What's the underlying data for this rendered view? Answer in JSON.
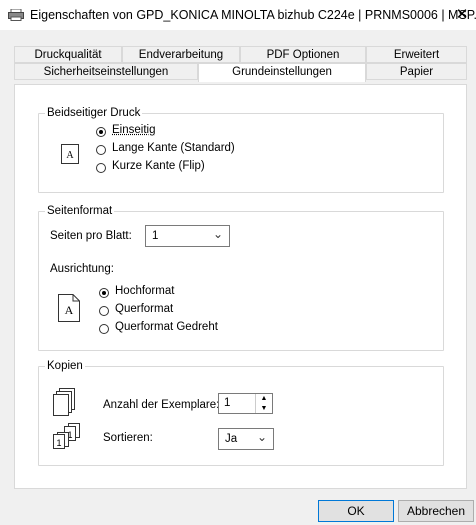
{
  "window": {
    "title": "Eigenschaften von GPD_KONICA MINOLTA bizhub C224e | PRNMS0006 | MSP...",
    "close_icon": "close-icon",
    "app_icon": "printer-icon"
  },
  "tabs": {
    "row1": [
      "Druckqualität",
      "Endverarbeitung",
      "PDF Optionen",
      "Erweitert"
    ],
    "row2": [
      "Sicherheitseinstellungen",
      "Grundeinstellungen",
      "Papier"
    ],
    "active": "Grundeinstellungen"
  },
  "duplex": {
    "legend": "Beidseitiger Druck",
    "icon": "page-a-icon",
    "options": [
      "Einseitig",
      "Lange Kante (Standard)",
      "Kurze Kante (Flip)"
    ],
    "selected": "Einseitig"
  },
  "layout": {
    "legend": "Seitenformat",
    "pages_label": "Seiten pro Blatt:",
    "pages_value": "1",
    "orientation_label": "Ausrichtung:",
    "icon": "portrait-page-icon",
    "options": [
      "Hochformat",
      "Querformat",
      "Querformat Gedreht"
    ],
    "selected": "Hochformat"
  },
  "copies": {
    "legend": "Kopien",
    "copies_label": "Anzahl der Exemplare:",
    "copies_value": "1",
    "copies_icon": "copies-stack-icon",
    "collate_label": "Sortieren:",
    "collate_value": "Ja",
    "collate_icon": "collate-icon"
  },
  "buttons": {
    "ok": "OK",
    "cancel": "Abbrechen"
  }
}
